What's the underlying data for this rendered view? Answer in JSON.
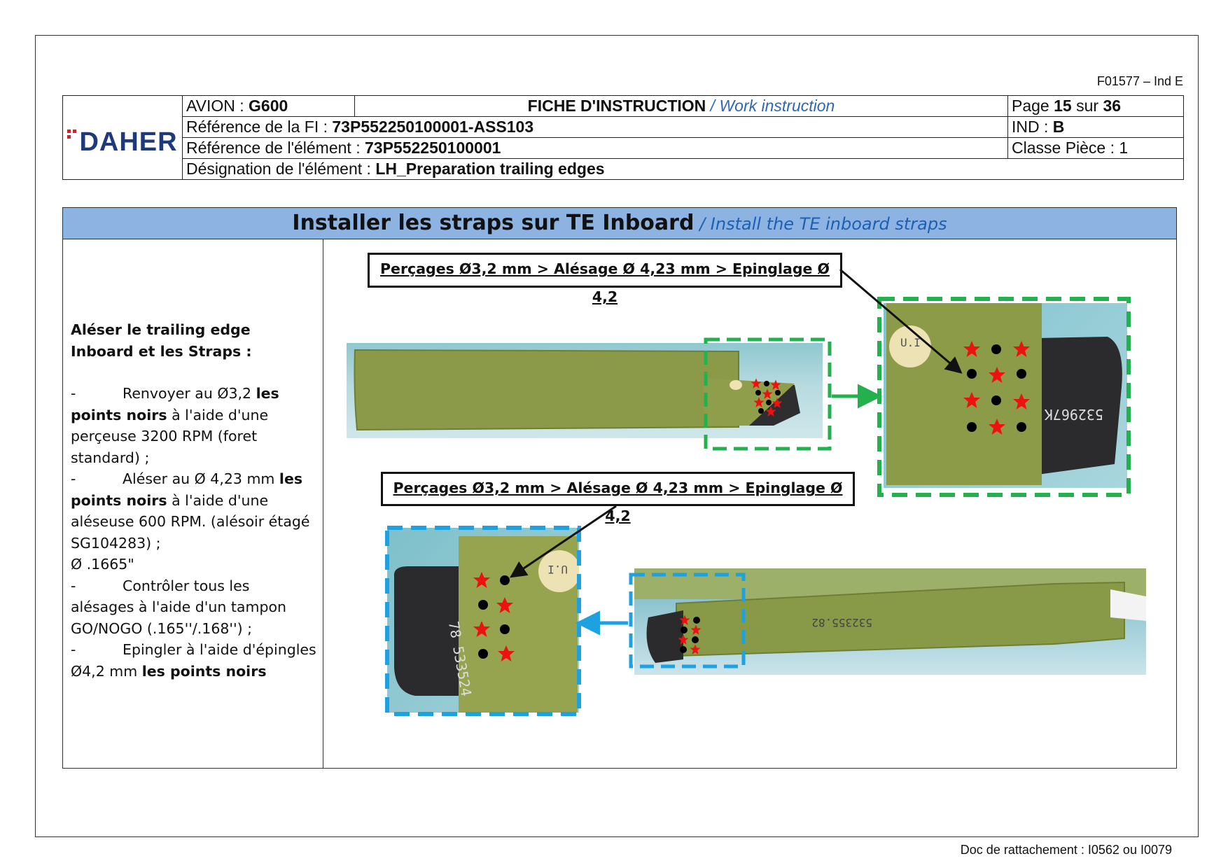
{
  "form_code": "F01577 – Ind E",
  "footer": "Doc de rattachement : I0562 ou I0079",
  "header": {
    "logo_text": "DAHER",
    "avion_label": "AVION : ",
    "avion_value": "G600",
    "title_fr": "FICHE D'INSTRUCTION",
    "title_en": " / Work instruction",
    "page_label": "Page ",
    "page_num": "15",
    "page_sep": " sur ",
    "page_total": "36",
    "ref_fi_label": "Référence de la FI : ",
    "ref_fi_value": "73P552250100001-ASS103",
    "ind_label": "IND : ",
    "ind_value": "B",
    "ref_elem_label": "Référence de l'élément : ",
    "ref_elem_value": "73P552250100001",
    "classe": "Classe Pièce : 1",
    "desig_label": "Désignation de l'élément : ",
    "desig_value": "LH_Preparation trailing edges"
  },
  "section": {
    "title_fr": "Installer les straps sur TE Inboard",
    "title_en": " / Install the TE inboard straps"
  },
  "instructions": {
    "heading": "Aléser le trailing edge Inboard et les Straps :",
    "s1_a": "Renvoyer au Ø3,2 ",
    "s1_b": "les points noirs",
    "s1_c": " à l'aide d'une perçeuse 3200 RPM (foret standard) ;",
    "s2_a": "Aléser au Ø 4,23 mm  ",
    "s2_b": "les points noirs",
    "s2_c": " à l'aide d'une aléseuse 600 RPM. (alésoir étagé SG104283) ;",
    "s2_d": "Ø .1665\"",
    "s3": "Contrôler tous les alésages à l'aide d'un tampon GO/NOGO (.165''/.168'') ;",
    "s4_a": "Epingler à l'aide d'épingles Ø4,2 mm ",
    "s4_b": "les points noirs",
    "dash": "-"
  },
  "callouts": {
    "top": "Perçages Ø3,2 mm > Alésage Ø 4,23 mm > Epinglage Ø 4,2",
    "bottom": "Perçages Ø3,2 mm > Alésage Ø 4,23 mm > Epinglage Ø 4,2"
  },
  "part_labels": {
    "ui_top": "U.I",
    "ui_bottom": "U.I",
    "serial_top": "532967K",
    "serial_bottom": "78 533524",
    "serial_long": "532355.82"
  },
  "colors": {
    "title_bar": "#8db3e2",
    "green_frame": "#22b14c",
    "blue_frame": "#1ea1e0",
    "star": "#ee1111",
    "logo_blue": "#1e3a78",
    "logo_red": "#d61f2c"
  }
}
